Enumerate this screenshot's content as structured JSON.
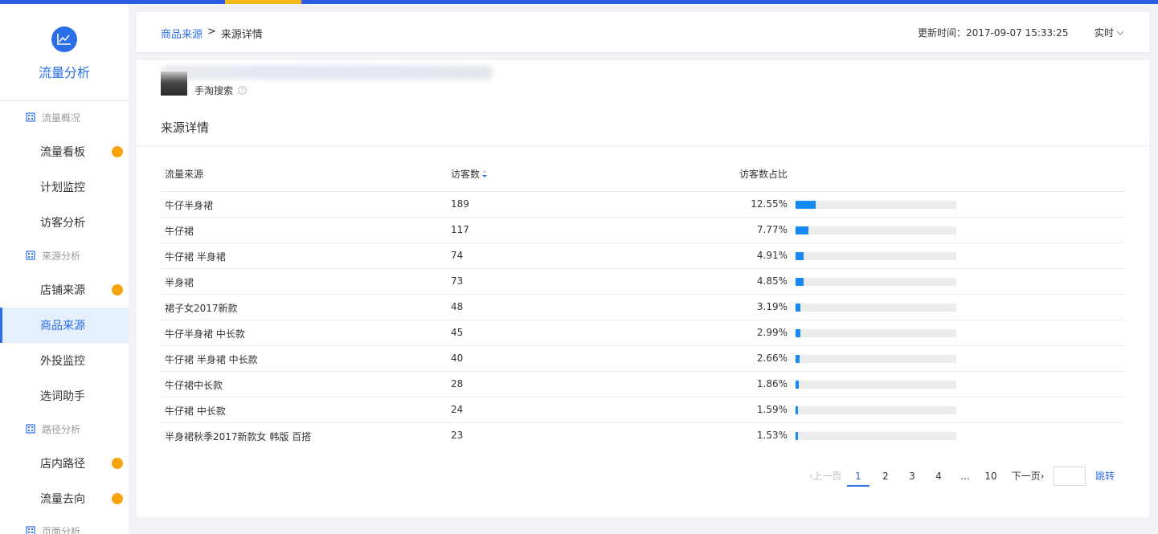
{
  "app": {
    "title": "流量分析",
    "accent_color": "#2b6ee8",
    "brand_icon": "line-chart-icon"
  },
  "sidebar": {
    "sections": [
      {
        "label": "流量概况",
        "icon": "building-icon"
      },
      {
        "label": "来源分析",
        "icon": "building-icon"
      },
      {
        "label": "路径分析",
        "icon": "building-icon"
      },
      {
        "label": "页面分析",
        "icon": "building-icon"
      }
    ],
    "items": [
      {
        "label": "流量看板",
        "badge": true
      },
      {
        "label": "计划监控",
        "badge": false
      },
      {
        "label": "访客分析",
        "badge": false
      },
      {
        "label": "店铺来源",
        "badge": true
      },
      {
        "label": "商品来源",
        "badge": false,
        "active": true
      },
      {
        "label": "外投监控",
        "badge": false
      },
      {
        "label": "选词助手",
        "badge": false
      },
      {
        "label": "店内路径",
        "badge": true
      },
      {
        "label": "流量去向",
        "badge": true
      }
    ]
  },
  "header": {
    "breadcrumb": {
      "parent": "商品来源",
      "separator": ">",
      "current": "来源详情"
    },
    "update_time": "更新时间：2017-09-07 15:33:25",
    "mode": "实时"
  },
  "product": {
    "source_label": "手淘搜索"
  },
  "detail": {
    "title": "来源详情",
    "columns": {
      "source": "流量来源",
      "visitors": "访客数",
      "share": "访客数占比"
    },
    "rows": [
      {
        "source": "牛仔半身裙",
        "visitors": "189",
        "share": "12.55%",
        "share_value": 12.55
      },
      {
        "source": "牛仔裙",
        "visitors": "117",
        "share": "7.77%",
        "share_value": 7.77
      },
      {
        "source": "牛仔裙 半身裙",
        "visitors": "74",
        "share": "4.91%",
        "share_value": 4.91
      },
      {
        "source": "半身裙",
        "visitors": "73",
        "share": "4.85%",
        "share_value": 4.85
      },
      {
        "source": "裙子女2017新款",
        "visitors": "48",
        "share": "3.19%",
        "share_value": 3.19
      },
      {
        "source": "牛仔半身裙 中长款",
        "visitors": "45",
        "share": "2.99%",
        "share_value": 2.99
      },
      {
        "source": "牛仔裙 半身裙 中长款",
        "visitors": "40",
        "share": "2.66%",
        "share_value": 2.66
      },
      {
        "source": "牛仔裙中长款",
        "visitors": "28",
        "share": "1.86%",
        "share_value": 1.86
      },
      {
        "source": "牛仔裙 中长款",
        "visitors": "24",
        "share": "1.59%",
        "share_value": 1.59
      },
      {
        "source": "半身裙秋季2017新款女 韩版 百搭",
        "visitors": "23",
        "share": "1.53%",
        "share_value": 1.53
      }
    ],
    "bar_color": "#1789f5"
  },
  "pagination": {
    "prev": "上一页",
    "pages": [
      "1",
      "2",
      "3",
      "4",
      "...",
      "10"
    ],
    "current": "1",
    "next": "下一页",
    "jump": "跳转"
  }
}
